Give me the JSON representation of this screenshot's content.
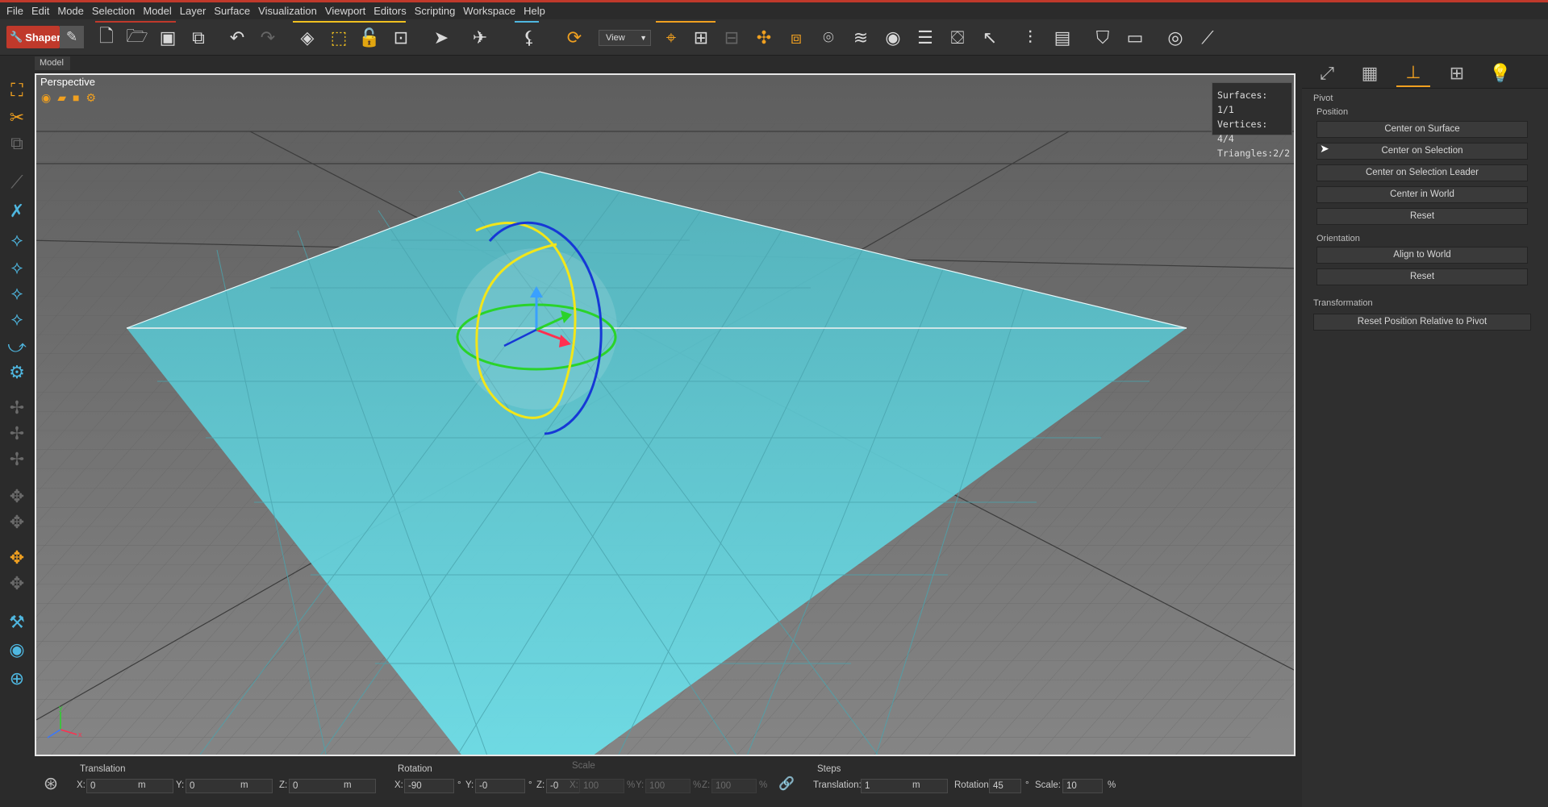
{
  "menu": [
    "File",
    "Edit",
    "Mode",
    "Selection",
    "Model",
    "Layer",
    "Surface",
    "Visualization",
    "Viewport",
    "Editors",
    "Scripting",
    "Workspace",
    "Help"
  ],
  "toolbar": {
    "app_button": "Shaper",
    "view_select": "View"
  },
  "model_tab": "Model",
  "viewport": {
    "title": "Perspective",
    "stats": {
      "surfaces": "Surfaces: 1/1",
      "vertices": "Vertices: 4/4",
      "triangles": "Triangles:2/2"
    },
    "axis": {
      "x": "x",
      "y": "y"
    }
  },
  "panel": {
    "pivot": "Pivot",
    "position": "Position",
    "buttons_position": [
      "Center on Surface",
      "Center on Selection",
      "Center on Selection Leader",
      "Center in World",
      "Reset"
    ],
    "orientation": "Orientation",
    "buttons_orientation": [
      "Align to World",
      "Reset"
    ],
    "transformation": "Transformation",
    "reset_relative": "Reset Position Relative to Pivot"
  },
  "bottom": {
    "translation": {
      "label": "Translation",
      "x": "0",
      "y": "0",
      "z": "0",
      "unit": "m"
    },
    "rotation": {
      "label": "Rotation",
      "x": "-90",
      "y": "-0",
      "z": "-0",
      "unit": "°"
    },
    "scale": {
      "label": "Scale",
      "x": "100",
      "y": "100",
      "z": "100",
      "unit": "%"
    },
    "steps": {
      "label": "Steps",
      "translation_label": "Translation:",
      "translation": "1",
      "translation_unit": "m",
      "rotation_label": "Rotation:",
      "rotation": "45",
      "rotation_unit": "°",
      "scale_label": "Scale:",
      "scale": "10",
      "scale_unit": "%"
    }
  },
  "colors": {
    "accent": "#f0a020",
    "tool_blue": "#4fb7e0",
    "plane": "#64d3df",
    "brand_red": "#c0392b"
  }
}
